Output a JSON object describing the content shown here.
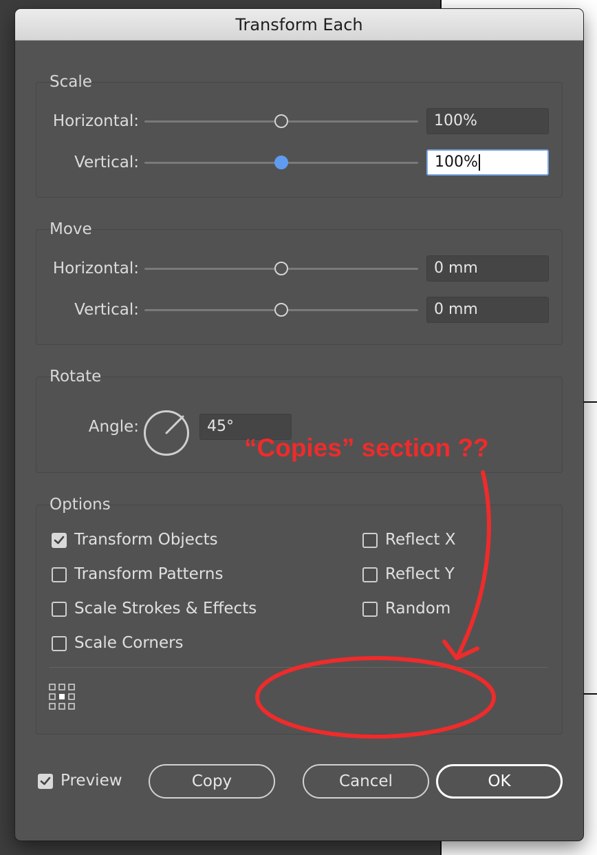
{
  "window": {
    "title": "Transform Each"
  },
  "scale": {
    "title": "Scale",
    "horizontal": {
      "label": "Horizontal:",
      "value": "100%",
      "slider": 0.5
    },
    "vertical": {
      "label": "Vertical:",
      "value": "100%",
      "slider": 0.5
    }
  },
  "move": {
    "title": "Move",
    "horizontal": {
      "label": "Horizontal:",
      "value": "0 mm",
      "slider": 0.5
    },
    "vertical": {
      "label": "Vertical:",
      "value": "0 mm",
      "slider": 0.5
    }
  },
  "rotate": {
    "title": "Rotate",
    "angle_label": "Angle:",
    "angle_value": "45°"
  },
  "options": {
    "title": "Options",
    "transform_objects": {
      "label": "Transform Objects",
      "checked": true
    },
    "transform_patterns": {
      "label": "Transform Patterns",
      "checked": false
    },
    "scale_strokes": {
      "label": "Scale Strokes & Effects",
      "checked": false
    },
    "scale_corners": {
      "label": "Scale Corners",
      "checked": false
    },
    "reflect_x": {
      "label": "Reflect X",
      "checked": false
    },
    "reflect_y": {
      "label": "Reflect Y",
      "checked": false
    },
    "random": {
      "label": "Random",
      "checked": false
    }
  },
  "footer": {
    "preview": {
      "label": "Preview",
      "checked": true
    },
    "copy_label": "Copy",
    "cancel_label": "Cancel",
    "ok_label": "OK"
  },
  "annotation": {
    "text": "“Copies” section ??",
    "color": "#ef2b2b"
  },
  "colors": {
    "dialog_bg": "#535353",
    "accent": "#5f9cf0"
  }
}
